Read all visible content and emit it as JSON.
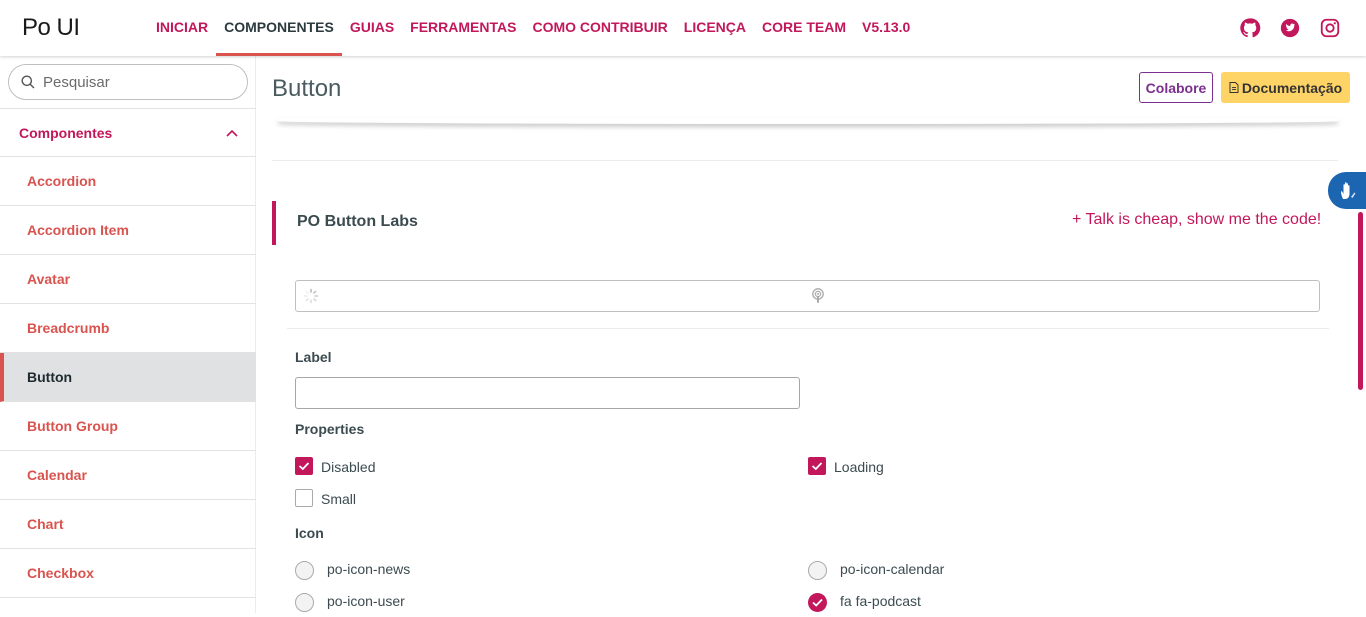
{
  "app": {
    "logo": "Po UI"
  },
  "nav": [
    {
      "label": "INICIAR",
      "active": false
    },
    {
      "label": "COMPONENTES",
      "active": true
    },
    {
      "label": "GUIAS",
      "active": false
    },
    {
      "label": "FERRAMENTAS",
      "active": false
    },
    {
      "label": "COMO CONTRIBUIR",
      "active": false
    },
    {
      "label": "LICENÇA",
      "active": false
    },
    {
      "label": "CORE TEAM",
      "active": false
    },
    {
      "label": "V5.13.0",
      "active": false
    }
  ],
  "social": [
    "github-icon",
    "twitter-icon",
    "instagram-icon"
  ],
  "sidebar": {
    "search_placeholder": "Pesquisar",
    "group_label": "Componentes",
    "items": [
      {
        "label": "Accordion",
        "active": false
      },
      {
        "label": "Accordion Item",
        "active": false
      },
      {
        "label": "Avatar",
        "active": false
      },
      {
        "label": "Breadcrumb",
        "active": false
      },
      {
        "label": "Button",
        "active": true
      },
      {
        "label": "Button Group",
        "active": false
      },
      {
        "label": "Calendar",
        "active": false
      },
      {
        "label": "Chart",
        "active": false
      },
      {
        "label": "Checkbox",
        "active": false
      }
    ]
  },
  "page": {
    "title": "Button",
    "colabore_label": "Colabore",
    "documentacao_label": "Documentação"
  },
  "labs": {
    "title": "PO Button Labs",
    "code_link": "+ Talk is cheap, show me the code!",
    "label_field_label": "Label",
    "label_value": "",
    "properties_label": "Properties",
    "properties": [
      {
        "label": "Disabled",
        "checked": true
      },
      {
        "label": "Loading",
        "checked": true
      },
      {
        "label": "Small",
        "checked": false
      }
    ],
    "icon_label": "Icon",
    "icons": [
      {
        "label": "po-icon-news",
        "selected": false
      },
      {
        "label": "po-icon-calendar",
        "selected": false
      },
      {
        "label": "po-icon-user",
        "selected": false
      },
      {
        "label": "fa fa-podcast",
        "selected": true
      }
    ]
  },
  "colors": {
    "accent": "#c2185b",
    "secondary": "#d9534f",
    "docs_button": "#ffd466",
    "colabore": "#7b2f8e"
  }
}
